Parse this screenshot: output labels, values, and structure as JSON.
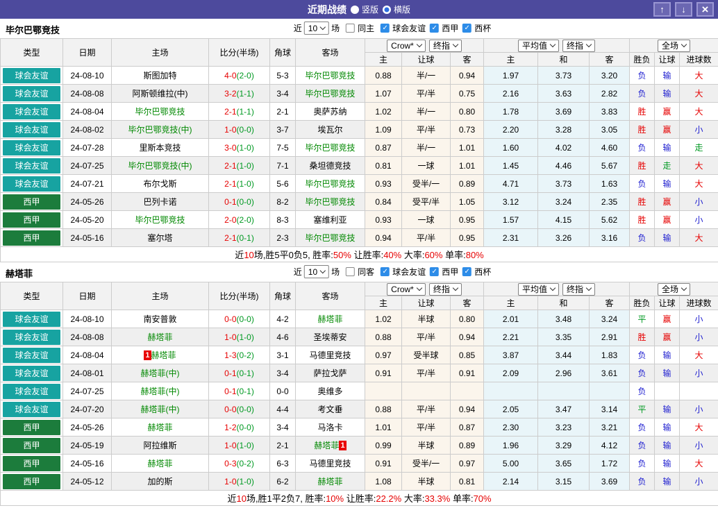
{
  "titlebar": {
    "title": "近期战绩",
    "vertical_label": "竖版",
    "horizontal_label": "横版"
  },
  "columns": {
    "type": "类型",
    "date": "日期",
    "home": "主场",
    "score": "比分(半场)",
    "corner": "角球",
    "away": "客场",
    "odds_home": "主",
    "odds_handicap": "让球",
    "odds_away": "客",
    "avg_home": "主",
    "avg_draw": "和",
    "avg_away": "客",
    "res_wl": "胜负",
    "res_handicap": "让球",
    "res_goals": "进球数"
  },
  "dropdowns": {
    "source": "Crow*",
    "final": "终指",
    "average": "平均值",
    "scope": "全场"
  },
  "filter_labels": {
    "near": "近",
    "count": "10",
    "games": "场",
    "leagues": [
      "球会友谊",
      "西甲",
      "西杯"
    ]
  },
  "colors": {
    "titlebar": "#4d4a9d",
    "friendly_badge": "#17a3a1",
    "liga_badge": "#1c7c3c",
    "team_highlight": "#008800",
    "score_red": "#e60000",
    "half_green": "#009922",
    "win_red": "#e60000",
    "lose_blue": "#2020d0",
    "draw_green": "#009922",
    "asian_odds_bg": "#fbf5ec",
    "euro_odds_bg": "#e9f5f9"
  },
  "sections": [
    {
      "team": "毕尔巴鄂竞技",
      "same_label": "同主",
      "rows": [
        {
          "league": "球会友谊",
          "lc": "friendly",
          "date": "24-08-10",
          "home": {
            "t": "斯图加特"
          },
          "score": "4-0",
          "half": "(2-0)",
          "corner": "5-3",
          "away": {
            "t": "毕尔巴鄂竞技",
            "hl": true
          },
          "odds": [
            "0.88",
            "半/一",
            "0.94"
          ],
          "avg": [
            "1.97",
            "3.73",
            "3.20"
          ],
          "res": [
            [
              "负",
              "b"
            ],
            [
              "输",
              "b"
            ],
            [
              "大",
              "r"
            ]
          ]
        },
        {
          "league": "球会友谊",
          "lc": "friendly",
          "date": "24-08-08",
          "home": {
            "t": "阿斯顿维拉(中)"
          },
          "score": "3-2",
          "half": "(1-1)",
          "corner": "3-4",
          "away": {
            "t": "毕尔巴鄂竞技",
            "hl": true
          },
          "odds": [
            "1.07",
            "平/半",
            "0.75"
          ],
          "avg": [
            "2.16",
            "3.63",
            "2.82"
          ],
          "res": [
            [
              "负",
              "b"
            ],
            [
              "输",
              "b"
            ],
            [
              "大",
              "r"
            ]
          ]
        },
        {
          "league": "球会友谊",
          "lc": "friendly",
          "date": "24-08-04",
          "home": {
            "t": "毕尔巴鄂竞技",
            "hl": true
          },
          "score": "2-1",
          "half": "(1-1)",
          "corner": "2-1",
          "away": {
            "t": "奥萨苏纳"
          },
          "odds": [
            "1.02",
            "半/一",
            "0.80"
          ],
          "avg": [
            "1.78",
            "3.69",
            "3.83"
          ],
          "res": [
            [
              "胜",
              "r"
            ],
            [
              "赢",
              "r"
            ],
            [
              "大",
              "r"
            ]
          ]
        },
        {
          "league": "球会友谊",
          "lc": "friendly",
          "date": "24-08-02",
          "home": {
            "t": "毕尔巴鄂竞技(中)",
            "hl": true
          },
          "score": "1-0",
          "half": "(0-0)",
          "corner": "3-7",
          "away": {
            "t": "埃瓦尔"
          },
          "odds": [
            "1.09",
            "平/半",
            "0.73"
          ],
          "avg": [
            "2.20",
            "3.28",
            "3.05"
          ],
          "res": [
            [
              "胜",
              "r"
            ],
            [
              "赢",
              "r"
            ],
            [
              "小",
              "b"
            ]
          ]
        },
        {
          "league": "球会友谊",
          "lc": "friendly",
          "date": "24-07-28",
          "home": {
            "t": "里斯本竞技"
          },
          "score": "3-0",
          "half": "(1-0)",
          "corner": "7-5",
          "away": {
            "t": "毕尔巴鄂竞技",
            "hl": true
          },
          "odds": [
            "0.87",
            "半/一",
            "1.01"
          ],
          "avg": [
            "1.60",
            "4.02",
            "4.60"
          ],
          "res": [
            [
              "负",
              "b"
            ],
            [
              "输",
              "b"
            ],
            [
              "走",
              "g"
            ]
          ]
        },
        {
          "league": "球会友谊",
          "lc": "friendly",
          "date": "24-07-25",
          "home": {
            "t": "毕尔巴鄂竞技(中)",
            "hl": true
          },
          "score": "2-1",
          "half": "(1-0)",
          "corner": "7-1",
          "away": {
            "t": "桑坦德竞技"
          },
          "odds": [
            "0.81",
            "一球",
            "1.01"
          ],
          "avg": [
            "1.45",
            "4.46",
            "5.67"
          ],
          "res": [
            [
              "胜",
              "r"
            ],
            [
              "走",
              "g"
            ],
            [
              "大",
              "r"
            ]
          ]
        },
        {
          "league": "球会友谊",
          "lc": "friendly",
          "date": "24-07-21",
          "home": {
            "t": "布尔戈斯"
          },
          "score": "2-1",
          "half": "(1-0)",
          "corner": "5-6",
          "away": {
            "t": "毕尔巴鄂竞技",
            "hl": true
          },
          "odds": [
            "0.93",
            "受半/一",
            "0.89"
          ],
          "avg": [
            "4.71",
            "3.73",
            "1.63"
          ],
          "res": [
            [
              "负",
              "b"
            ],
            [
              "输",
              "b"
            ],
            [
              "大",
              "r"
            ]
          ]
        },
        {
          "league": "西甲",
          "lc": "liga",
          "date": "24-05-26",
          "home": {
            "t": "巴列卡诺"
          },
          "score": "0-1",
          "half": "(0-0)",
          "corner": "8-2",
          "away": {
            "t": "毕尔巴鄂竞技",
            "hl": true
          },
          "odds": [
            "0.84",
            "受平/半",
            "1.05"
          ],
          "avg": [
            "3.12",
            "3.24",
            "2.35"
          ],
          "res": [
            [
              "胜",
              "r"
            ],
            [
              "赢",
              "r"
            ],
            [
              "小",
              "b"
            ]
          ]
        },
        {
          "league": "西甲",
          "lc": "liga",
          "date": "24-05-20",
          "home": {
            "t": "毕尔巴鄂竞技",
            "hl": true
          },
          "score": "2-0",
          "half": "(2-0)",
          "corner": "8-3",
          "away": {
            "t": "塞维利亚"
          },
          "odds": [
            "0.93",
            "一球",
            "0.95"
          ],
          "avg": [
            "1.57",
            "4.15",
            "5.62"
          ],
          "res": [
            [
              "胜",
              "r"
            ],
            [
              "赢",
              "r"
            ],
            [
              "小",
              "b"
            ]
          ]
        },
        {
          "league": "西甲",
          "lc": "liga",
          "date": "24-05-16",
          "home": {
            "t": "塞尔塔"
          },
          "score": "2-1",
          "half": "(0-1)",
          "corner": "2-3",
          "away": {
            "t": "毕尔巴鄂竞技",
            "hl": true
          },
          "odds": [
            "0.94",
            "平/半",
            "0.95"
          ],
          "avg": [
            "2.31",
            "3.26",
            "3.16"
          ],
          "res": [
            [
              "负",
              "b"
            ],
            [
              "输",
              "b"
            ],
            [
              "大",
              "r"
            ]
          ]
        }
      ],
      "summary": [
        {
          "t": "近"
        },
        {
          "t": "10",
          "r": true
        },
        {
          "t": "场,胜5平0负5, 胜率:"
        },
        {
          "t": "50%",
          "r": true
        },
        {
          "t": " 让胜率:"
        },
        {
          "t": "40%",
          "r": true
        },
        {
          "t": " 大率:"
        },
        {
          "t": "60%",
          "r": true
        },
        {
          "t": " 单率:"
        },
        {
          "t": "80%",
          "r": true
        }
      ]
    },
    {
      "team": "赫塔菲",
      "same_label": "同客",
      "rows": [
        {
          "league": "球会友谊",
          "lc": "friendly",
          "date": "24-08-10",
          "home": {
            "t": "南安普敦"
          },
          "score": "0-0",
          "half": "(0-0)",
          "corner": "4-2",
          "away": {
            "t": "赫塔菲",
            "hl": true
          },
          "odds": [
            "1.02",
            "半球",
            "0.80"
          ],
          "avg": [
            "2.01",
            "3.48",
            "3.24"
          ],
          "res": [
            [
              "平",
              "g"
            ],
            [
              "赢",
              "r"
            ],
            [
              "小",
              "b"
            ]
          ]
        },
        {
          "league": "球会友谊",
          "lc": "friendly",
          "date": "24-08-08",
          "home": {
            "t": "赫塔菲",
            "hl": true
          },
          "score": "1-0",
          "half": "(1-0)",
          "corner": "4-6",
          "away": {
            "t": "圣埃蒂安"
          },
          "odds": [
            "0.88",
            "平/半",
            "0.94"
          ],
          "avg": [
            "2.21",
            "3.35",
            "2.91"
          ],
          "res": [
            [
              "胜",
              "r"
            ],
            [
              "赢",
              "r"
            ],
            [
              "小",
              "b"
            ]
          ]
        },
        {
          "league": "球会友谊",
          "lc": "friendly",
          "date": "24-08-04",
          "home": {
            "t": "赫塔菲",
            "hl": true,
            "card_pre": "1"
          },
          "score": "1-3",
          "half": "(0-2)",
          "corner": "3-1",
          "away": {
            "t": "马德里竞技"
          },
          "odds": [
            "0.97",
            "受半球",
            "0.85"
          ],
          "avg": [
            "3.87",
            "3.44",
            "1.83"
          ],
          "res": [
            [
              "负",
              "b"
            ],
            [
              "输",
              "b"
            ],
            [
              "大",
              "r"
            ]
          ]
        },
        {
          "league": "球会友谊",
          "lc": "friendly",
          "date": "24-08-01",
          "home": {
            "t": "赫塔菲(中)",
            "hl": true
          },
          "score": "0-1",
          "half": "(0-1)",
          "corner": "3-4",
          "away": {
            "t": "萨拉戈萨"
          },
          "odds": [
            "0.91",
            "平/半",
            "0.91"
          ],
          "avg": [
            "2.09",
            "2.96",
            "3.61"
          ],
          "res": [
            [
              "负",
              "b"
            ],
            [
              "输",
              "b"
            ],
            [
              "小",
              "b"
            ]
          ]
        },
        {
          "league": "球会友谊",
          "lc": "friendly",
          "date": "24-07-25",
          "home": {
            "t": "赫塔菲(中)",
            "hl": true
          },
          "score": "0-1",
          "half": "(0-1)",
          "corner": "0-0",
          "away": {
            "t": "奥维多"
          },
          "odds": [
            "",
            "",
            ""
          ],
          "avg": [
            "",
            "",
            ""
          ],
          "res": [
            [
              "负",
              "b"
            ],
            [
              "",
              ""
            ],
            [
              "",
              ""
            ]
          ]
        },
        {
          "league": "球会友谊",
          "lc": "friendly",
          "date": "24-07-20",
          "home": {
            "t": "赫塔菲(中)",
            "hl": true
          },
          "score": "0-0",
          "half": "(0-0)",
          "corner": "4-4",
          "away": {
            "t": "考文垂"
          },
          "odds": [
            "0.88",
            "平/半",
            "0.94"
          ],
          "avg": [
            "2.05",
            "3.47",
            "3.14"
          ],
          "res": [
            [
              "平",
              "g"
            ],
            [
              "输",
              "b"
            ],
            [
              "小",
              "b"
            ]
          ]
        },
        {
          "league": "西甲",
          "lc": "liga",
          "date": "24-05-26",
          "home": {
            "t": "赫塔菲",
            "hl": true
          },
          "score": "1-2",
          "half": "(0-0)",
          "corner": "3-4",
          "away": {
            "t": "马洛卡"
          },
          "odds": [
            "1.01",
            "平/半",
            "0.87"
          ],
          "avg": [
            "2.30",
            "3.23",
            "3.21"
          ],
          "res": [
            [
              "负",
              "b"
            ],
            [
              "输",
              "b"
            ],
            [
              "大",
              "r"
            ]
          ]
        },
        {
          "league": "西甲",
          "lc": "liga",
          "date": "24-05-19",
          "home": {
            "t": "阿拉维斯"
          },
          "score": "1-0",
          "half": "(1-0)",
          "corner": "2-1",
          "away": {
            "t": "赫塔菲",
            "hl": true,
            "card_post": "1"
          },
          "odds": [
            "0.99",
            "半球",
            "0.89"
          ],
          "avg": [
            "1.96",
            "3.29",
            "4.12"
          ],
          "res": [
            [
              "负",
              "b"
            ],
            [
              "输",
              "b"
            ],
            [
              "小",
              "b"
            ]
          ]
        },
        {
          "league": "西甲",
          "lc": "liga",
          "date": "24-05-16",
          "home": {
            "t": "赫塔菲",
            "hl": true
          },
          "score": "0-3",
          "half": "(0-2)",
          "corner": "6-3",
          "away": {
            "t": "马德里竞技"
          },
          "odds": [
            "0.91",
            "受半/一",
            "0.97"
          ],
          "avg": [
            "5.00",
            "3.65",
            "1.72"
          ],
          "res": [
            [
              "负",
              "b"
            ],
            [
              "输",
              "b"
            ],
            [
              "大",
              "r"
            ]
          ]
        },
        {
          "league": "西甲",
          "lc": "liga",
          "date": "24-05-12",
          "home": {
            "t": "加的斯"
          },
          "score": "1-0",
          "half": "(1-0)",
          "corner": "6-2",
          "away": {
            "t": "赫塔菲",
            "hl": true
          },
          "odds": [
            "1.08",
            "半球",
            "0.81"
          ],
          "avg": [
            "2.14",
            "3.15",
            "3.69"
          ],
          "res": [
            [
              "负",
              "b"
            ],
            [
              "输",
              "b"
            ],
            [
              "小",
              "b"
            ]
          ]
        }
      ],
      "summary": [
        {
          "t": "近"
        },
        {
          "t": "10",
          "r": true
        },
        {
          "t": "场,胜1平2负7, 胜率:"
        },
        {
          "t": "10%",
          "r": true
        },
        {
          "t": " 让胜率:"
        },
        {
          "t": "22.2%",
          "r": true
        },
        {
          "t": " 大率:"
        },
        {
          "t": "33.3%",
          "r": true
        },
        {
          "t": " 单率:"
        },
        {
          "t": "70%",
          "r": true
        }
      ]
    }
  ]
}
